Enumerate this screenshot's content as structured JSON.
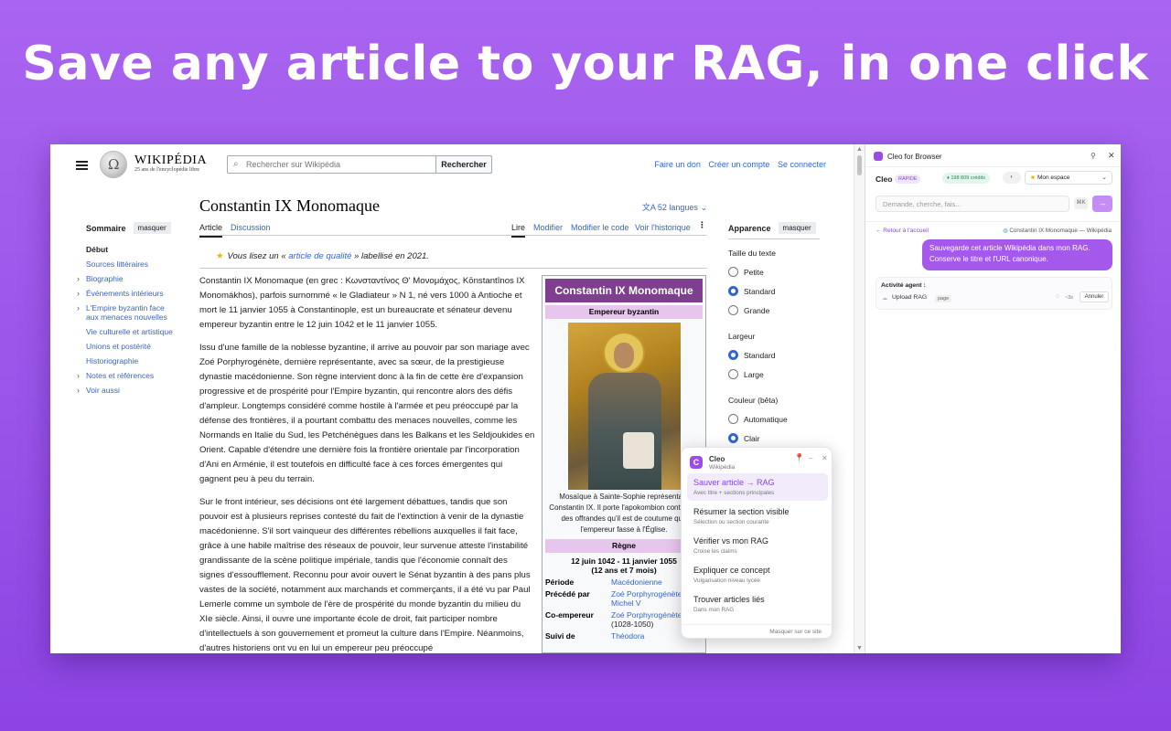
{
  "headline": "Save any article to your RAG, in one click",
  "wikipedia": {
    "logo_word": "WIKIPÉDIA",
    "tagline": "25 ans de l'encyclopédie libre",
    "search_placeholder": "Rechercher sur Wikipédia",
    "search_button": "Rechercher",
    "top_links": [
      "Faire un don",
      "Créer un compte",
      "Se connecter"
    ],
    "toc": {
      "title": "Sommaire",
      "hide": "masquer",
      "items": [
        {
          "label": "Début",
          "expandable": false
        },
        {
          "label": "Sources littéraires",
          "expandable": false
        },
        {
          "label": "Biographie",
          "expandable": true
        },
        {
          "label": "Événements intérieurs",
          "expandable": true
        },
        {
          "label": "L'Empire byzantin face aux menaces nouvelles",
          "expandable": true
        },
        {
          "label": "Vie culturelle et artistique",
          "expandable": false
        },
        {
          "label": "Unions et postérité",
          "expandable": false
        },
        {
          "label": "Historiographie",
          "expandable": false
        },
        {
          "label": "Notes et références",
          "expandable": true
        },
        {
          "label": "Voir aussi",
          "expandable": true
        }
      ]
    },
    "title": "Constantin IX Monomaque",
    "languages": "52 langues",
    "tabs": {
      "article": "Article",
      "discussion": "Discussion",
      "read": "Lire",
      "edit": "Modifier",
      "edit_code": "Modifier le code",
      "history": "Voir l'historique"
    },
    "banner": {
      "pre": "Vous lisez un « ",
      "link": "article de qualité",
      "post": " » labellisé en 2021."
    },
    "paragraph_1": "Constantin IX Monomaque (en grec : Κωνσταντίνος Θ' Μονομάχος, Kōnstantînos IX Monomákhos), parfois surnommé « le Gladiateur » N 1, né vers 1000 à Antioche et mort le 11 janvier 1055 à Constantinople, est un bureaucrate et sénateur devenu empereur byzantin entre le 12 juin 1042 et le 11 janvier 1055.",
    "paragraph_2": "Issu d'une famille de la noblesse byzantine, il arrive au pouvoir par son mariage avec Zoé Porphyrogénète, dernière représentante, avec sa sœur, de la prestigieuse dynastie macédonienne. Son règne intervient donc à la fin de cette ère d'expansion progressive et de prospérité pour l'Empire byzantin, qui rencontre alors des défis d'ampleur. Longtemps considéré comme hostile à l'armée et peu préoccupé par la défense des frontières, il a pourtant combattu des menaces nouvelles, comme les Normands en Italie du Sud, les Petchénègues dans les Balkans et les Seldjoukides en Orient. Capable d'étendre une dernière fois la frontière orientale par l'incorporation d'Ani en Arménie, il est toutefois en difficulté face à ces forces émergentes qui gagnent peu à peu du terrain.",
    "paragraph_3": "Sur le front intérieur, ses décisions ont été largement débattues, tandis que son pouvoir est à plusieurs reprises contesté du fait de l'extinction à venir de la dynastie macédonienne. S'il sort vainqueur des différentes rébellions auxquelles il fait face, grâce à une habile maîtrise des réseaux de pouvoir, leur survenue atteste l'instabilité grandissante de la scène politique impériale, tandis que l'économie connaît des signes d'essoufflement. Reconnu pour avoir ouvert le Sénat byzantin à des pans plus vastes de la société, notamment aux marchands et commerçants, il a été vu par Paul Lemerle comme un symbole de l'ère de prospérité du monde byzantin du milieu du XIe siècle. Ainsi, il ouvre une importante école de droit, fait participer nombre d'intellectuels à son gouvernement et promeut la culture dans l'Empire. Néanmoins, d'autres historiens ont vu en lui un empereur peu préoccupé",
    "infobox": {
      "title": "Constantin IX Monomaque",
      "subtitle": "Empereur byzantin",
      "caption": "Mosaïque à Sainte-Sophie représentant Constantin IX. Il porte l'apokombion contenant des offrandes qu'il est de coutume que l'empereur fasse à l'Église.",
      "reign_header": "Règne",
      "reign_dates": "12 juin 1042 - 11 janvier 1055",
      "reign_duration": "(12 ans et 7 mois)",
      "rows": [
        {
          "k": "Période",
          "v": "Macédonienne",
          "extra": ""
        },
        {
          "k": "Précédé par",
          "v": "Zoé Porphyrogénète",
          "extra": "Michel V"
        },
        {
          "k": "Co-empereur",
          "v": "Zoé Porphyrogénète",
          "extra": "(1028-1050)"
        },
        {
          "k": "Suivi de",
          "v": "Théodora",
          "extra": ""
        }
      ]
    },
    "appearance": {
      "title": "Apparence",
      "hide": "masquer",
      "text_size": "Taille du texte",
      "text_options": [
        "Petite",
        "Standard",
        "Grande"
      ],
      "width": "Largeur",
      "width_options": [
        "Standard",
        "Large"
      ],
      "color": "Couleur (bêta)",
      "color_options": [
        "Automatique",
        "Clair"
      ]
    }
  },
  "popup": {
    "name": "Cleo",
    "site": "Wikipédia",
    "actions": [
      {
        "title": "Sauver article → RAG",
        "sub": "Avec titre + sections principales"
      },
      {
        "title": "Résumer la section visible",
        "sub": "Sélection ou section courante"
      },
      {
        "title": "Vérifier vs mon RAG",
        "sub": "Croise les claims"
      },
      {
        "title": "Expliquer ce concept",
        "sub": "Vulgarisation niveau lycée"
      },
      {
        "title": "Trouver articles liés",
        "sub": "Dans mon RAG"
      }
    ],
    "hide_on_site": "Masquer sur ce site"
  },
  "cleo_panel": {
    "title": "Cleo for Browser",
    "brand": "Cleo",
    "mode_badge": "RAPIDE",
    "credits": "198 809 crédits",
    "workspace": "Mon espace",
    "input_placeholder": "Demande, cherche, fais...",
    "send_label": "→",
    "back": "← Retour à l'accueil",
    "context": "Constantin IX Monomaque — Wikipédia",
    "user_message": "Sauvegarde cet article Wikipédia dans mon RAG. Conserve le titre et l'URL canonique.",
    "activity_title": "Activité agent :",
    "activity_item": "Upload RAG",
    "activity_tag": "page",
    "activity_time": "~3s",
    "cancel": "Annuler"
  },
  "colors": {
    "background": "#9b56ea",
    "link": "#3366cc",
    "infobox_title": "#7e3f8f",
    "infobox_sub": "#e7c6ed",
    "cleo_accent": "#a558ec"
  }
}
